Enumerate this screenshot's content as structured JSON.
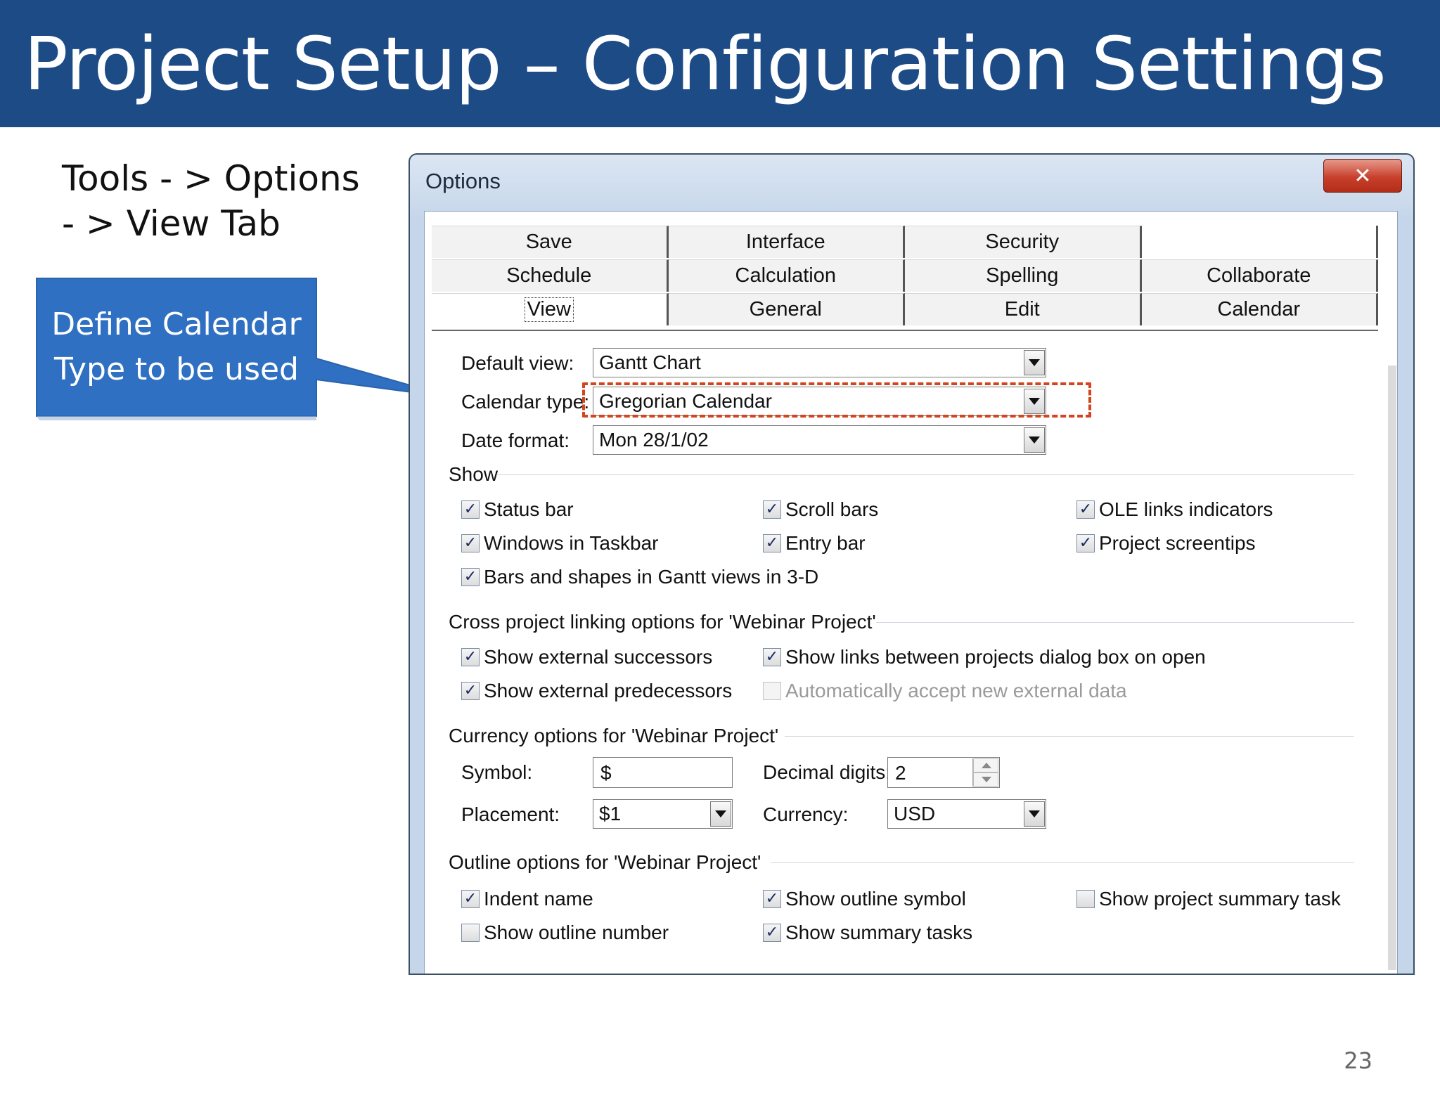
{
  "slide": {
    "title": "Project Setup – Configuration Settings",
    "nav_line1": "Tools - > Options",
    "nav_line2": "- > View Tab",
    "callout_line1": "Define Calendar",
    "callout_line2": "Type to be used",
    "page_number": "23"
  },
  "colors": {
    "title_bar": "#1d4b86",
    "callout": "#2f70c2",
    "highlight": "#d2451e"
  },
  "dialog": {
    "title": "Options",
    "close_icon": "close-icon",
    "tabs": {
      "row1": [
        "Save",
        "Interface",
        "Security",
        ""
      ],
      "row2": [
        "Schedule",
        "Calculation",
        "Spelling",
        "Collaborate"
      ],
      "row3": [
        "View",
        "General",
        "Edit",
        "Calendar"
      ]
    },
    "active_tab": "View",
    "fields": {
      "default_view": {
        "label": "Default view:",
        "value": "Gantt Chart"
      },
      "calendar_type": {
        "label": "Calendar type:",
        "value": "Gregorian Calendar"
      },
      "date_format": {
        "label": "Date format:",
        "value": "Mon 28/1/02"
      }
    },
    "show": {
      "label": "Show",
      "items": [
        {
          "label": "Status bar",
          "checked": true
        },
        {
          "label": "Scroll bars",
          "checked": true
        },
        {
          "label": "OLE links indicators",
          "checked": true
        },
        {
          "label": "Windows in Taskbar",
          "checked": true
        },
        {
          "label": "Entry bar",
          "checked": true
        },
        {
          "label": "Project screentips",
          "checked": true
        },
        {
          "label": "Bars and shapes in Gantt views in 3-D",
          "checked": true
        }
      ]
    },
    "cross_project": {
      "label": "Cross project linking options for 'Webinar Project'",
      "items": [
        {
          "label": "Show external successors",
          "checked": true
        },
        {
          "label": "Show links between projects dialog box on open",
          "checked": true
        },
        {
          "label": "Show external predecessors",
          "checked": true
        },
        {
          "label": "Automatically accept new external data",
          "checked": false,
          "disabled": true
        }
      ]
    },
    "currency": {
      "label": "Currency options for 'Webinar Project'",
      "symbol_label": "Symbol:",
      "symbol_value": "$",
      "decimal_label": "Decimal digits:",
      "decimal_value": "2",
      "placement_label": "Placement:",
      "placement_value": "$1",
      "currency_label": "Currency:",
      "currency_value": "USD"
    },
    "outline": {
      "label": "Outline options for 'Webinar Project'",
      "items": [
        {
          "label": "Indent name",
          "checked": true
        },
        {
          "label": "Show outline symbol",
          "checked": true
        },
        {
          "label": "Show project summary task",
          "checked": false
        },
        {
          "label": "Show outline number",
          "checked": false
        },
        {
          "label": "Show summary tasks",
          "checked": true
        }
      ]
    }
  }
}
